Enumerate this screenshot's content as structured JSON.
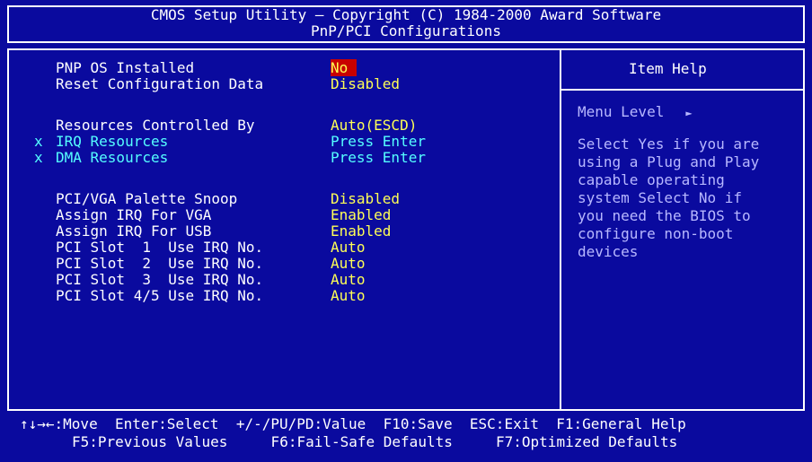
{
  "header": {
    "line1": "CMOS Setup Utility – Copyright (C) 1984-2000 Award Software",
    "line2": "PnP/PCI Configurations"
  },
  "settings": [
    {
      "label": "PNP OS Installed",
      "value": "No",
      "selected": true
    },
    {
      "label": "Reset Configuration Data",
      "value": "Disabled"
    },
    {
      "label": "Resources Controlled By",
      "value": "Auto(ESCD)"
    },
    {
      "marker": "x",
      "label": "IRQ Resources",
      "value": "Press Enter",
      "disabled": true
    },
    {
      "marker": "x",
      "label": "DMA Resources",
      "value": "Press Enter",
      "disabled": true
    },
    {
      "label": "PCI/VGA Palette Snoop",
      "value": "Disabled"
    },
    {
      "label": "Assign IRQ For VGA",
      "value": "Enabled"
    },
    {
      "label": "Assign IRQ For USB",
      "value": "Enabled"
    },
    {
      "label": "PCI Slot  1  Use IRQ No.",
      "value": "Auto"
    },
    {
      "label": "PCI Slot  2  Use IRQ No.",
      "value": "Auto"
    },
    {
      "label": "PCI Slot  3  Use IRQ No.",
      "value": "Auto"
    },
    {
      "label": "PCI Slot 4/5 Use IRQ No.",
      "value": "Auto"
    }
  ],
  "help": {
    "title": "Item Help",
    "menu_level": "Menu Level",
    "arrow": "►",
    "text_lines": [
      "Select Yes if you are",
      "using a Plug and Play",
      "capable operating",
      "system Select No if",
      "you need the BIOS to",
      "configure non-boot",
      "devices"
    ]
  },
  "footer": {
    "line1": "↑↓→←:Move  Enter:Select  +/-/PU/PD:Value  F10:Save  ESC:Exit  F1:General Help",
    "line2": "F5:Previous Values     F6:Fail-Safe Defaults     F7:Optimized Defaults"
  },
  "colors": {
    "background": "#0a0a9e",
    "value": "#ffff55",
    "disabled": "#55ffff",
    "highlight": "#c80000",
    "help_text": "#b8b8ff"
  }
}
